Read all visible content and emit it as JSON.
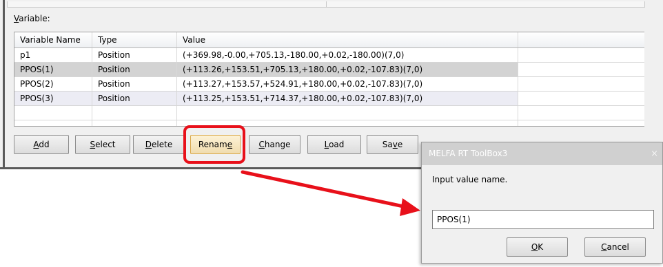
{
  "variables_panel": {
    "label": "Variable:",
    "columns": [
      "Variable Name",
      "Type",
      "Value",
      ""
    ],
    "rows": [
      {
        "name": "p1",
        "type": "Position",
        "value": "(+369.98,-0.00,+705.13,-180.00,+0.02,-180.00)(7,0)"
      },
      {
        "name": "PPOS(1)",
        "type": "Position",
        "value": "(+113.26,+153.51,+705.13,+180.00,+0.02,-107.83)(7,0)"
      },
      {
        "name": "PPOS(2)",
        "type": "Position",
        "value": "(+113.27,+153.57,+524.91,+180.00,+0.02,-107.83)(7,0)"
      },
      {
        "name": "PPOS(3)",
        "type": "Position",
        "value": "(+113.25,+153.51,+714.37,+180.00,+0.02,-107.83)(7,0)"
      },
      {
        "name": "",
        "type": "",
        "value": ""
      },
      {
        "name": "",
        "type": "",
        "value": ""
      }
    ],
    "selected_row": 1
  },
  "buttons": {
    "add": "Add",
    "select": "Select",
    "delete": "Delete",
    "rename": "Rename",
    "change": "Change",
    "load": "Load",
    "save": "Save"
  },
  "annotation": {
    "highlight_color": "#e8101a",
    "target": "rename-button"
  },
  "dialog": {
    "title": "MELFA RT ToolBox3",
    "close_symbol": "×",
    "prompt": "Input value name.",
    "input_value": "PPOS(1)",
    "ok": "OK",
    "cancel": "Cancel"
  }
}
